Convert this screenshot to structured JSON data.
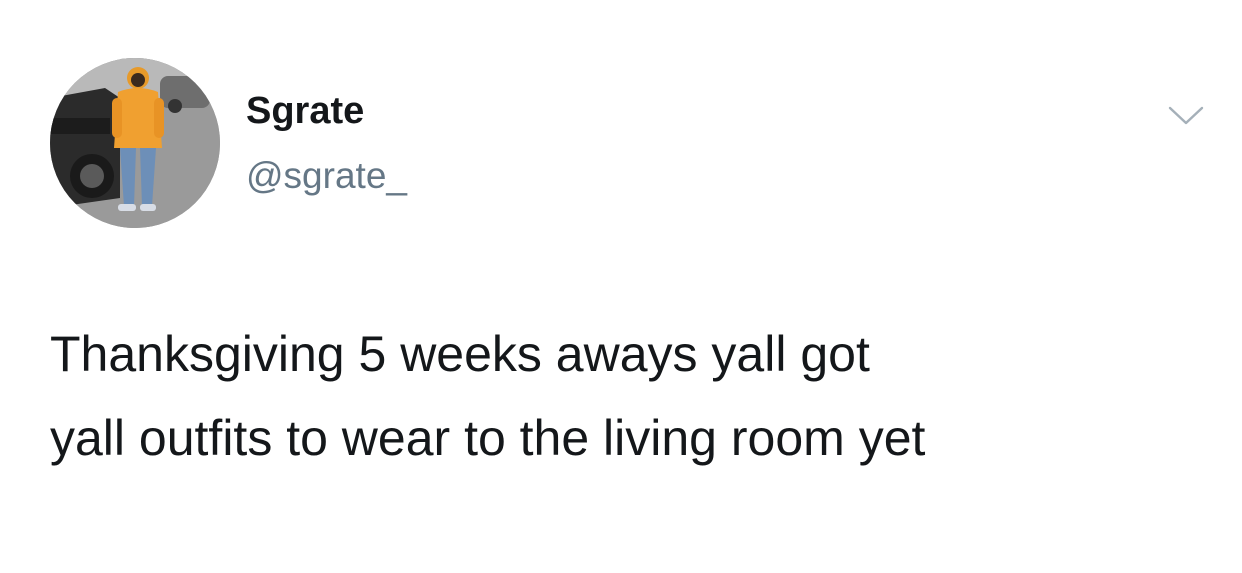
{
  "author": {
    "display_name": "Sgrate",
    "handle": "@sgrate_",
    "avatar_icon": "profile-photo"
  },
  "menu": {
    "icon": "chevron-down-icon"
  },
  "tweet": {
    "lines": [
      "Thanksgiving 5 weeks aways yall got",
      "yall outfits to wear to the living room yet"
    ]
  },
  "colors": {
    "text": "#14171a",
    "secondary_text": "#657786",
    "caret": "#a5b0b9",
    "background": "#ffffff"
  }
}
